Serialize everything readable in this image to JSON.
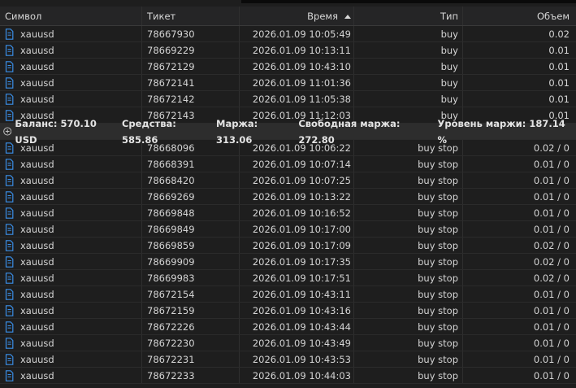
{
  "columns": {
    "symbol": "Символ",
    "ticket": "Тикет",
    "time": "Время",
    "type": "Тип",
    "volume": "Объем"
  },
  "positions": [
    {
      "symbol": "xauusd",
      "ticket": "78667930",
      "time": "2026.01.09 10:05:49",
      "type": "buy",
      "volume": "0.02"
    },
    {
      "symbol": "xauusd",
      "ticket": "78669229",
      "time": "2026.01.09 10:13:11",
      "type": "buy",
      "volume": "0.01"
    },
    {
      "symbol": "xauusd",
      "ticket": "78672129",
      "time": "2026.01.09 10:43:10",
      "type": "buy",
      "volume": "0.01"
    },
    {
      "symbol": "xauusd",
      "ticket": "78672141",
      "time": "2026.01.09 11:01:36",
      "type": "buy",
      "volume": "0.01"
    },
    {
      "symbol": "xauusd",
      "ticket": "78672142",
      "time": "2026.01.09 11:05:38",
      "type": "buy",
      "volume": "0.01"
    },
    {
      "symbol": "xauusd",
      "ticket": "78672143",
      "time": "2026.01.09 11:12:03",
      "type": "buy",
      "volume": "0.01"
    }
  ],
  "summary": {
    "balance": "Баланс: 570.10 USD",
    "equity": "Средства: 585.86",
    "margin": "Маржа: 313.06",
    "free_margin": "Свободная маржа: 272.80",
    "margin_level": "Уровень маржи: 187.14 %"
  },
  "orders": [
    {
      "symbol": "xauusd",
      "ticket": "78668096",
      "time": "2026.01.09 10:06:22",
      "type": "buy stop",
      "volume": "0.02 / 0"
    },
    {
      "symbol": "xauusd",
      "ticket": "78668391",
      "time": "2026.01.09 10:07:14",
      "type": "buy stop",
      "volume": "0.01 / 0"
    },
    {
      "symbol": "xauusd",
      "ticket": "78668420",
      "time": "2026.01.09 10:07:25",
      "type": "buy stop",
      "volume": "0.01 / 0"
    },
    {
      "symbol": "xauusd",
      "ticket": "78669269",
      "time": "2026.01.09 10:13:22",
      "type": "buy stop",
      "volume": "0.01 / 0"
    },
    {
      "symbol": "xauusd",
      "ticket": "78669848",
      "time": "2026.01.09 10:16:52",
      "type": "buy stop",
      "volume": "0.01 / 0"
    },
    {
      "symbol": "xauusd",
      "ticket": "78669849",
      "time": "2026.01.09 10:17:00",
      "type": "buy stop",
      "volume": "0.01 / 0"
    },
    {
      "symbol": "xauusd",
      "ticket": "78669859",
      "time": "2026.01.09 10:17:09",
      "type": "buy stop",
      "volume": "0.02 / 0"
    },
    {
      "symbol": "xauusd",
      "ticket": "78669909",
      "time": "2026.01.09 10:17:35",
      "type": "buy stop",
      "volume": "0.02 / 0"
    },
    {
      "symbol": "xauusd",
      "ticket": "78669983",
      "time": "2026.01.09 10:17:51",
      "type": "buy stop",
      "volume": "0.02 / 0"
    },
    {
      "symbol": "xauusd",
      "ticket": "78672154",
      "time": "2026.01.09 10:43:11",
      "type": "buy stop",
      "volume": "0.01 / 0"
    },
    {
      "symbol": "xauusd",
      "ticket": "78672159",
      "time": "2026.01.09 10:43:16",
      "type": "buy stop",
      "volume": "0.01 / 0"
    },
    {
      "symbol": "xauusd",
      "ticket": "78672226",
      "time": "2026.01.09 10:43:44",
      "type": "buy stop",
      "volume": "0.01 / 0"
    },
    {
      "symbol": "xauusd",
      "ticket": "78672230",
      "time": "2026.01.09 10:43:49",
      "type": "buy stop",
      "volume": "0.01 / 0"
    },
    {
      "symbol": "xauusd",
      "ticket": "78672231",
      "time": "2026.01.09 10:43:53",
      "type": "buy stop",
      "volume": "0.01 / 0"
    },
    {
      "symbol": "xauusd",
      "ticket": "78672233",
      "time": "2026.01.09 10:44:03",
      "type": "buy stop",
      "volume": "0.01 / 0"
    }
  ],
  "icons": {
    "row": "position-document-icon",
    "summary": "expand-plus-icon"
  },
  "colors": {
    "icon_blue": "#3a8ee6",
    "background": "#1e1e1e",
    "summary_bg": "#2d2d2d"
  }
}
